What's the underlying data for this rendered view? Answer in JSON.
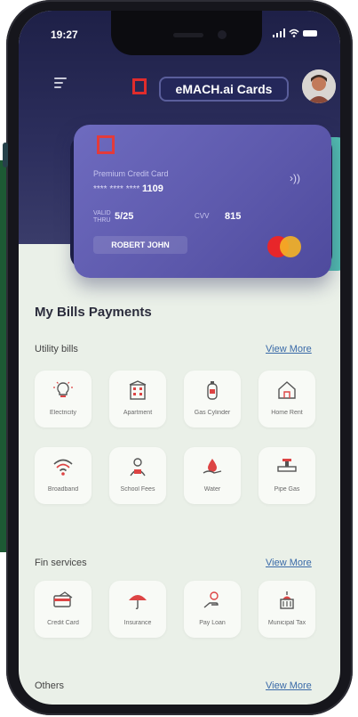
{
  "status": {
    "time": "19:27"
  },
  "header": {
    "title": "eMACH.ai Cards"
  },
  "card": {
    "type_label": "Premium Credit Card",
    "masked_number": "**** **** ****",
    "last4": "1109",
    "valid_label": "VALID THRU",
    "expiry": "5/25",
    "cvv_label": "CVV",
    "cvv": "815",
    "holder": "ROBERT JOHN"
  },
  "bills": {
    "title": "My Bills Payments",
    "utility": {
      "label": "Utility bills",
      "view_more": "View More",
      "items": [
        {
          "label": "Electricity",
          "icon": "lightbulb-icon"
        },
        {
          "label": "Apartment",
          "icon": "apartment-icon"
        },
        {
          "label": "Gas Cylinder",
          "icon": "gas-cylinder-icon"
        },
        {
          "label": "Home Rent",
          "icon": "home-rent-icon"
        },
        {
          "label": "Broadband",
          "icon": "wifi-icon"
        },
        {
          "label": "School Fees",
          "icon": "school-fees-icon"
        },
        {
          "label": "Water",
          "icon": "water-icon"
        },
        {
          "label": "Pipe Gas",
          "icon": "pipe-gas-icon"
        }
      ]
    },
    "fin": {
      "label": "Fin services",
      "view_more": "View More",
      "items": [
        {
          "label": "Credit Card",
          "icon": "credit-card-icon"
        },
        {
          "label": "Insurance",
          "icon": "umbrella-icon"
        },
        {
          "label": "Pay Loan",
          "icon": "pay-loan-icon"
        },
        {
          "label": "Municipal Tax",
          "icon": "municipal-building-icon"
        }
      ]
    },
    "others": {
      "label": "Others",
      "view_more": "View More"
    }
  }
}
